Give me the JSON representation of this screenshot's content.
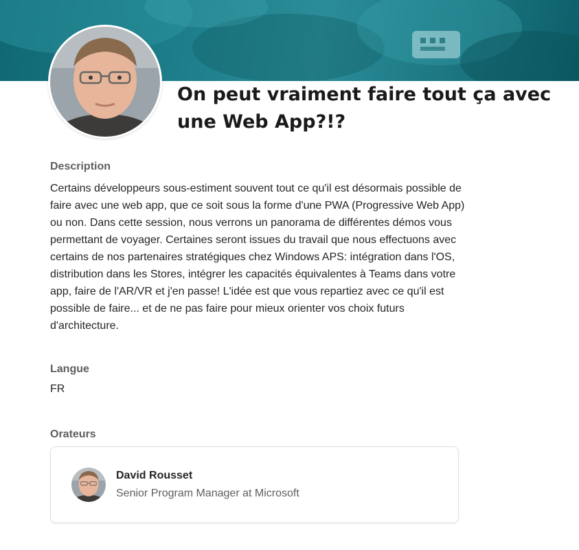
{
  "session": {
    "title": "On peut vraiment faire tout ça avec une Web App?!?"
  },
  "description": {
    "label": "Description",
    "text": "Certains développeurs sous-estiment souvent tout ce qu'il est désormais possible de faire avec une web app, que ce soit sous la forme d'une PWA (Progressive Web App) ou non. Dans cette session, nous verrons un panorama de différentes démos vous permettant de voyager. Certaines seront issues du travail que nous effectuons avec certains de nos partenaires stratégiques chez Windows APS: intégration dans l'OS, distribution dans les Stores, intégrer les capacités équivalentes à Teams dans votre app, faire de l'AR/VR et j'en passe! L'idée est que vous repartiez avec ce qu'il est possible de faire... et de ne pas faire pour mieux orienter vos choix futurs d'architecture."
  },
  "language": {
    "label": "Langue",
    "value": "FR"
  },
  "speakers": {
    "label": "Orateurs",
    "items": [
      {
        "name": "David Rousset",
        "role": "Senior Program Manager at Microsoft"
      }
    ]
  },
  "colors": {
    "banner": "#1c7d89",
    "label_text": "#605e5c",
    "body_text": "#252423"
  }
}
